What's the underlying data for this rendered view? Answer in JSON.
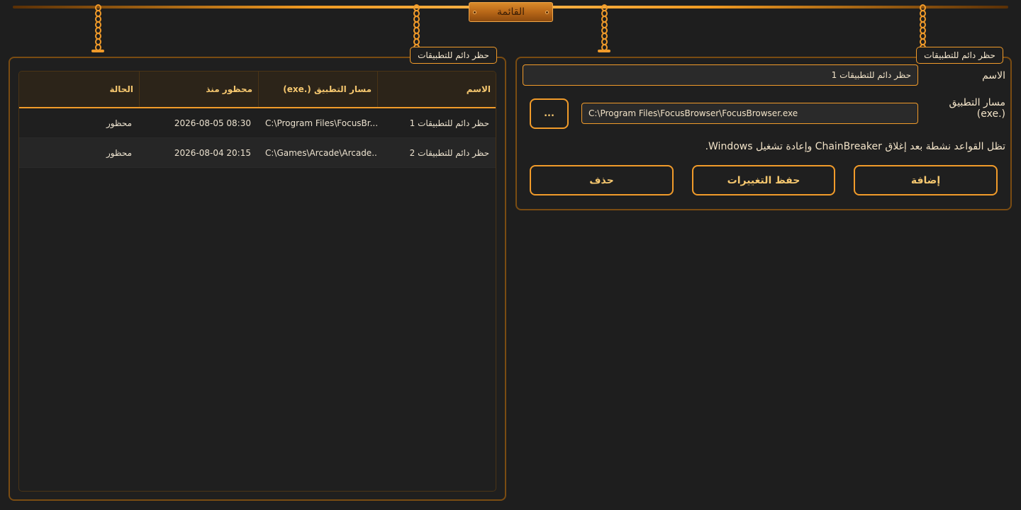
{
  "header": {
    "title": "القائمة"
  },
  "left_panel": {
    "tag": "حظر دائم للتطبيقات",
    "columns": [
      "الاسم",
      "مسار التطبيق (.exe)",
      "محظور منذ",
      "الحالة"
    ],
    "rows": [
      {
        "name": "حظر دائم للتطبيقات 1",
        "path": "C:\\Program Files\\FocusBr...",
        "since": "2026-08-05 08:30",
        "status": "محظور"
      },
      {
        "name": "حظر دائم للتطبيقات 2",
        "path": "C:\\Games\\Arcade\\Arcade....",
        "since": "2026-08-04 20:15",
        "status": "محظور"
      }
    ]
  },
  "right_panel": {
    "tag": "حظر دائم للتطبيقات",
    "name_label": "الاسم",
    "name_value": "حظر دائم للتطبيقات 1",
    "path_label": "مسار التطبيق (.exe)",
    "path_value": "C:\\Program Files\\FocusBrowser\\FocusBrowser.exe",
    "browse_label": "...",
    "note": "تظل القواعد نشطة بعد إغلاق ChainBreaker وإعادة تشغيل Windows.",
    "add_label": "إضافة",
    "save_label": "حفظ التغييرات",
    "delete_label": "حذف"
  },
  "colors": {
    "accent": "#f19b2a",
    "background": "#1e1e1e",
    "panel_border": "#7a4c12",
    "header_text": "#f5c76f"
  },
  "icons": [
    "chain-icon",
    "rivet-icon"
  ]
}
